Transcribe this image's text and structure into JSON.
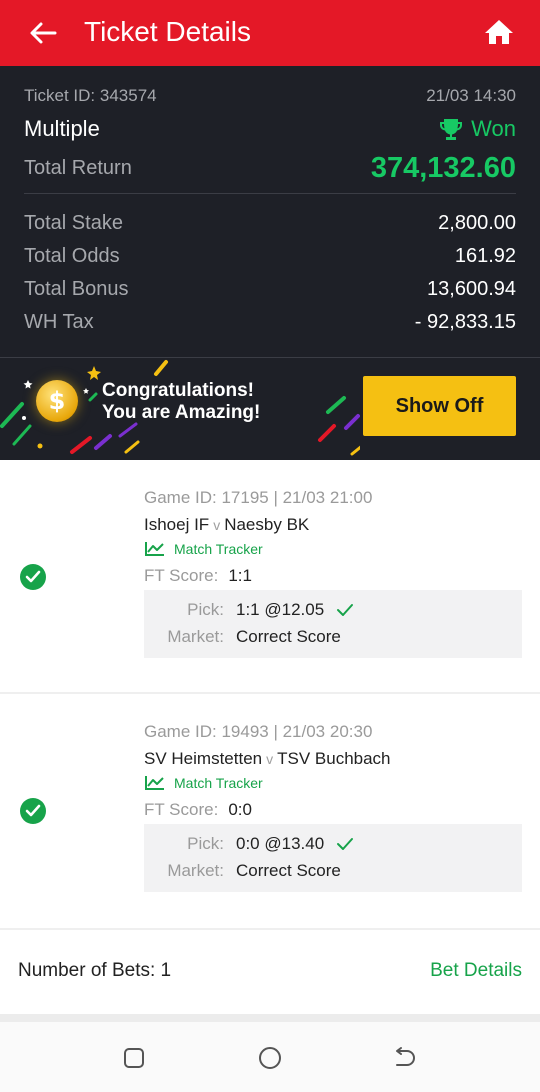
{
  "header": {
    "title": "Ticket Details",
    "back_icon": "arrow-left-icon",
    "home_icon": "home-icon"
  },
  "summary": {
    "ticket_id": "Ticket ID: 343574",
    "datetime": "21/03 14:30",
    "bet_type": "Multiple",
    "status": "Won",
    "total_return_label": "Total Return",
    "total_return": "374,132.60",
    "rows": [
      {
        "label": "Total Stake",
        "value": "2,800.00"
      },
      {
        "label": "Total Odds",
        "value": "161.92"
      },
      {
        "label": "Total Bonus",
        "value": "13,600.94"
      },
      {
        "label": "WH Tax",
        "value": "- 92,833.15"
      }
    ],
    "accent_color": "#17c964"
  },
  "promo": {
    "line1": "Congratulations!",
    "line2": "You are Amazing!",
    "button": "Show Off"
  },
  "bets": [
    {
      "game": "Game ID: 17195 | 21/03 21:00",
      "home": "Ishoej IF",
      "vs": "v",
      "away": "Naesby BK",
      "tracker": "Match Tracker",
      "ft_label": "FT Score:",
      "ft_value": "1:1",
      "pick_label": "Pick:",
      "pick_value": "1:1 @12.05",
      "market_label": "Market:",
      "market_value": "Correct Score"
    },
    {
      "game": "Game ID: 19493 | 21/03 20:30",
      "home": "SV Heimstetten",
      "vs": "v",
      "away": "TSV Buchbach",
      "tracker": "Match Tracker",
      "ft_label": "FT Score:",
      "ft_value": "0:0",
      "pick_label": "Pick:",
      "pick_value": "0:0 @13.40",
      "market_label": "Market:",
      "market_value": "Correct Score"
    }
  ],
  "footer": {
    "number_of_bets": "Number of Bets: 1",
    "bet_details": "Bet Details"
  },
  "colors": {
    "header": "#e41827",
    "panel": "#1e2027",
    "green": "#17a34a",
    "button": "#f5c012"
  }
}
